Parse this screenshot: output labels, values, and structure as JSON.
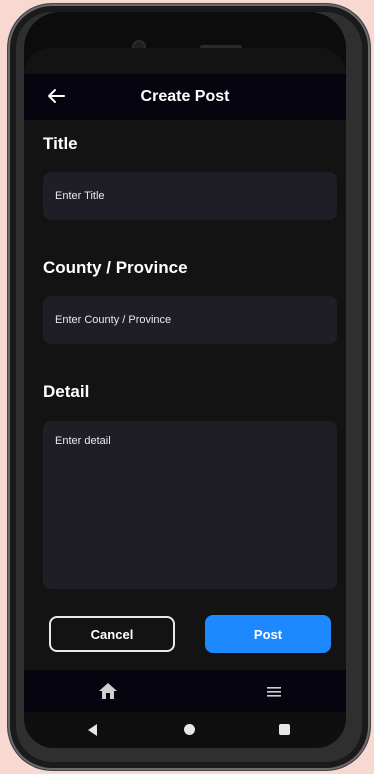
{
  "header": {
    "title": "Create Post",
    "back_icon": "arrow-left-icon"
  },
  "form": {
    "title": {
      "label": "Title",
      "placeholder": "Enter Title"
    },
    "county": {
      "label": "County / Province",
      "placeholder": "Enter County / Province"
    },
    "detail": {
      "label": "Detail",
      "placeholder": "Enter detail"
    }
  },
  "actions": {
    "cancel_label": "Cancel",
    "post_label": "Post"
  },
  "colors": {
    "accent": "#1e88ff",
    "background": "#131313",
    "field": "#1f1e26"
  },
  "bottom_nav": {
    "items": [
      "home-icon",
      "menu-icon"
    ]
  },
  "system_nav": {
    "items": [
      "back-triangle-icon",
      "home-circle-icon",
      "recent-square-icon"
    ]
  }
}
